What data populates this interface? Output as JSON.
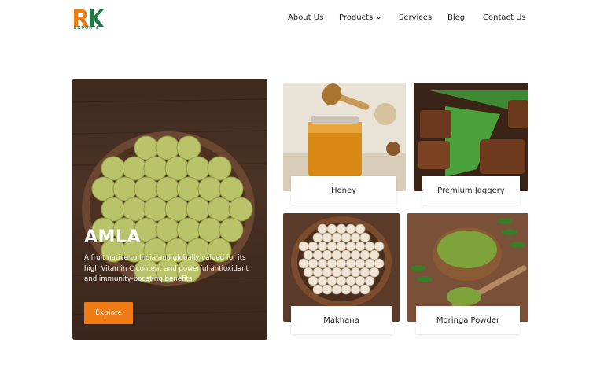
{
  "brand": {
    "logo_text": "RK",
    "logo_sub": "EXPORTS",
    "colors": {
      "orange": "#f07b12",
      "green": "#1f7a45"
    }
  },
  "nav": {
    "about": "About Us",
    "products": "Products",
    "services": "Services",
    "blog": "Blog",
    "contact": "Contact Us"
  },
  "hero": {
    "title": "AMLA",
    "description": "A fruit native to India and globally valued for its high Vitamin C content and powerful antioxidant and immunity-boosting benefits.",
    "button": "Explore"
  },
  "products": [
    {
      "name": "Honey",
      "image": "honey-jar-dipper"
    },
    {
      "name": "Premium Jaggery",
      "image": "jaggery-blocks-leaf"
    },
    {
      "name": "Makhana",
      "image": "makhana-bowl"
    },
    {
      "name": "Moringa Powder",
      "image": "moringa-powder-bowl"
    }
  ]
}
